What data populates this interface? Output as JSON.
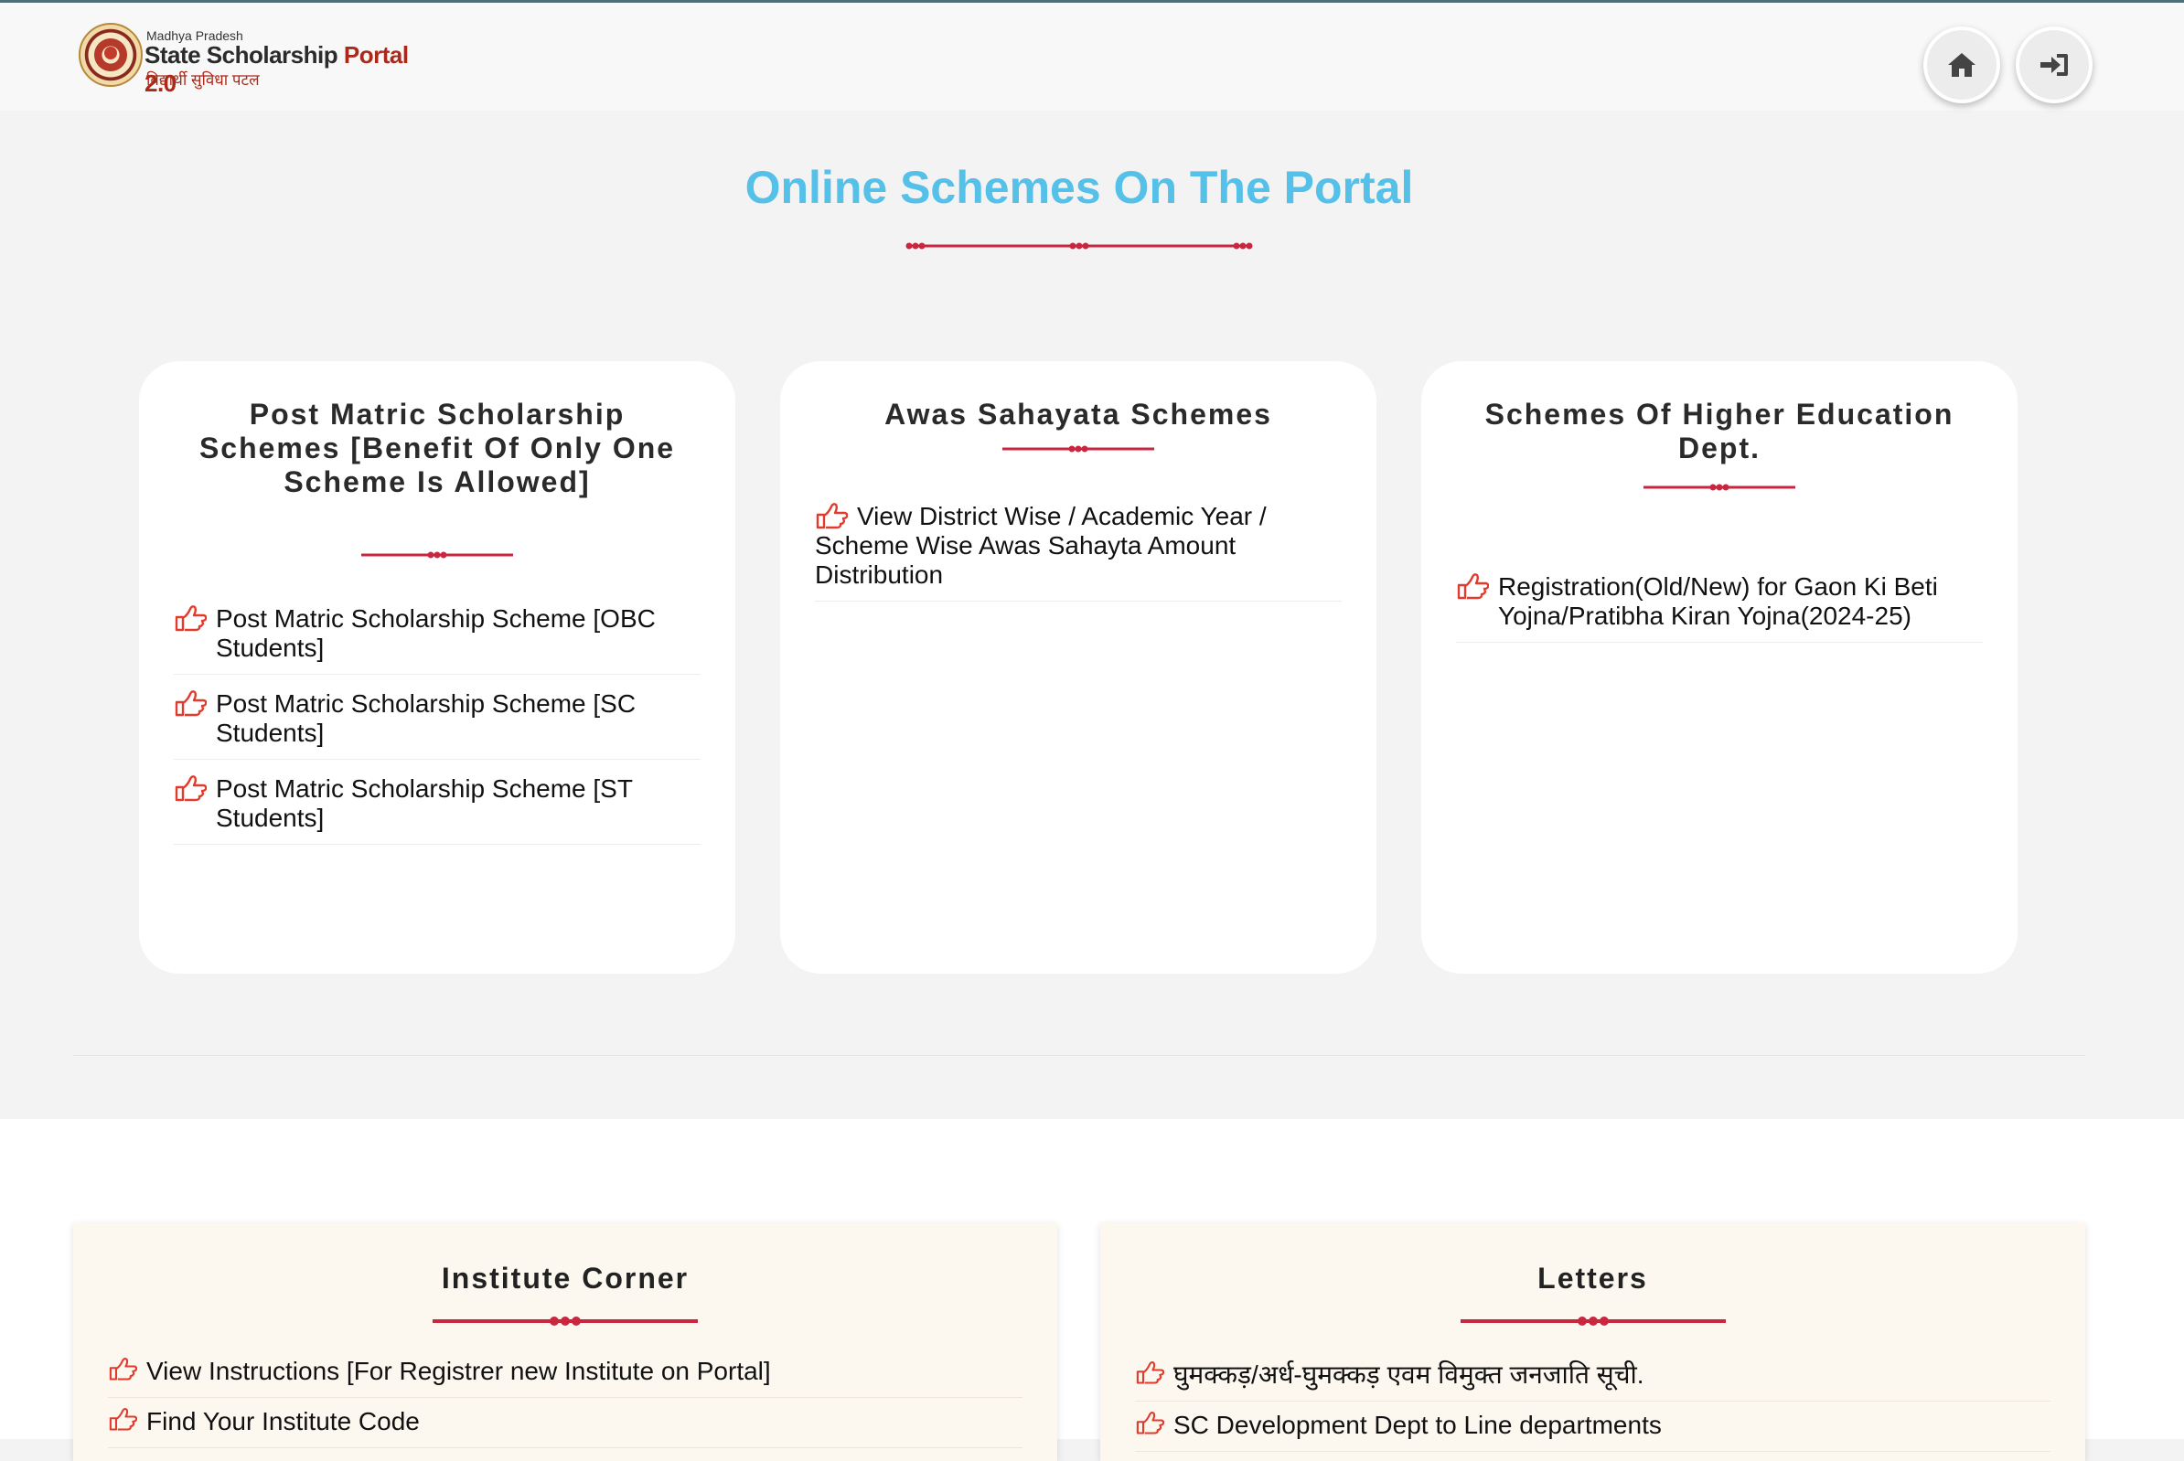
{
  "header": {
    "logo_small": "Madhya Pradesh",
    "logo_main": "State Scholarship",
    "logo_portal": "Portal 2.0",
    "logo_hindi": "विद्यार्थी सुविधा पटल",
    "home_icon": "home-icon",
    "login_icon": "sign-in-icon"
  },
  "main": {
    "title": "Online Schemes On The Portal"
  },
  "cards": [
    {
      "title": "Post Matric Scholarship Schemes [Benefit Of Only One Scheme Is Allowed]",
      "items": [
        "Post Matric Scholarship Scheme [OBC Students]",
        "Post Matric Scholarship Scheme [SC Students]",
        "Post Matric Scholarship Scheme [ST Students]"
      ]
    },
    {
      "title": "Awas Sahayata Schemes",
      "items": [
        "View District Wise / Academic Year / Scheme Wise Awas Sahayta Amount Distribution"
      ]
    },
    {
      "title": "Schemes Of Higher Education Dept.",
      "items": [
        "Registration(Old/New) for Gaon Ki Beti Yojna/Pratibha Kiran Yojna(2024-25)"
      ]
    }
  ],
  "panels": [
    {
      "title": "Institute Corner",
      "items": [
        "View Instructions [For Registrer new Institute on Portal]",
        "Find Your Institute Code"
      ]
    },
    {
      "title": "Letters",
      "items": [
        "घुमक्कड़/अर्ध-घुमक्कड़ एवम विमुक्त जनजाति सूची.",
        "SC Development Dept to Line departments"
      ]
    }
  ],
  "colors": {
    "title_blue": "#55c0e8",
    "accent_red": "#c9263f",
    "hand_red": "#e23a2c"
  }
}
